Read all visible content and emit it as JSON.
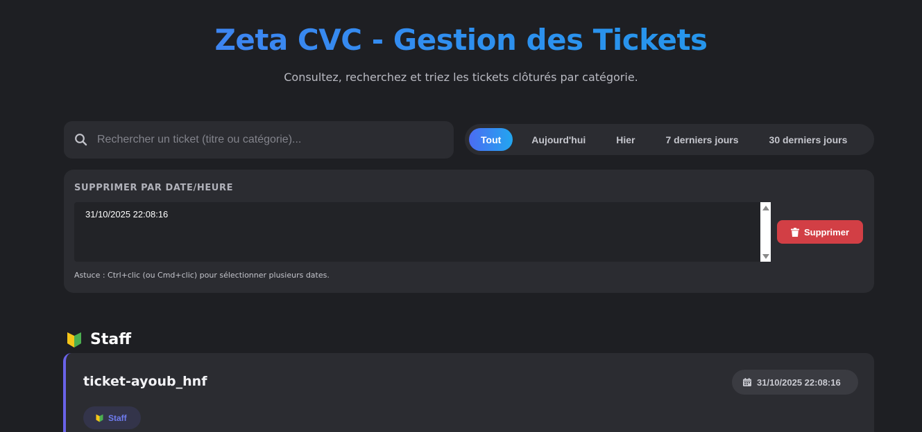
{
  "header": {
    "title": "Zeta CVC - Gestion des Tickets",
    "subtitle": "Consultez, recherchez et triez les tickets clôturés par catégorie."
  },
  "search": {
    "placeholder": "Rechercher un ticket (titre ou catégorie)...",
    "value": ""
  },
  "filters": {
    "active": "Tout",
    "items": [
      "Tout",
      "Aujourd'hui",
      "Hier",
      "7 derniers jours",
      "30 derniers jours"
    ]
  },
  "delete_panel": {
    "title": "SUPPRIMER PAR DATE/HEURE",
    "options": [
      "31/10/2025 22:08:16"
    ],
    "button_label": "Supprimer",
    "hint": "Astuce : Ctrl+clic (ou Cmd+clic) pour sélectionner plusieurs dates."
  },
  "sections": [
    {
      "title": "Staff",
      "icon": "beginner-shield-icon",
      "tickets": [
        {
          "name": "ticket-ayoub_hnf",
          "date": "31/10/2025 22:08:16",
          "category": "Staff"
        }
      ]
    }
  ],
  "colors": {
    "background": "#1e1f23",
    "panel": "#2b2c31",
    "accent_blue": "#3f8cf0",
    "danger": "#d23f45",
    "card_border": "#6a63e8"
  }
}
